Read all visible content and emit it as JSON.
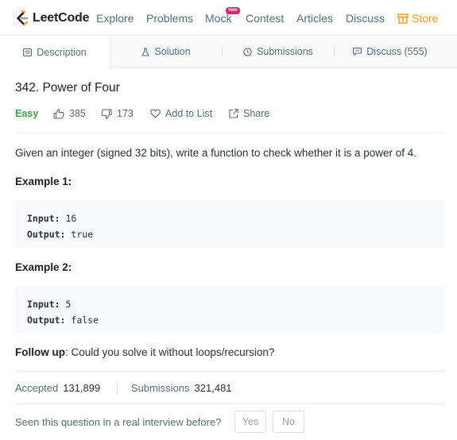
{
  "brand": {
    "name": "LeetCode"
  },
  "nav": {
    "links": [
      "Explore",
      "Problems",
      "Mock",
      "Contest",
      "Articles",
      "Discuss"
    ],
    "new_badge": "new",
    "store": "Store",
    "store_color": "#ff9800"
  },
  "tabs": [
    {
      "label": "Description",
      "icon": "description-icon"
    },
    {
      "label": "Solution",
      "icon": "flask-icon"
    },
    {
      "label": "Submissions",
      "icon": "clock-icon"
    },
    {
      "label": "Discuss (555)",
      "icon": "discuss-icon"
    }
  ],
  "problem": {
    "title": "342. Power of Four",
    "difficulty": "Easy",
    "difficulty_color": "#43a047",
    "likes": "385",
    "dislikes": "173",
    "add_to_list": "Add to List",
    "share": "Share",
    "description": "Given an integer (signed 32 bits), write a function to check whether it is a power of 4."
  },
  "examples": [
    {
      "title": "Example 1:",
      "input_label": "Input:",
      "input": "16",
      "output_label": "Output:",
      "output": "true"
    },
    {
      "title": "Example 2:",
      "input_label": "Input:",
      "input": "5",
      "output_label": "Output:",
      "output": "false"
    }
  ],
  "follow_up": {
    "label": "Follow up",
    "text": ": Could you solve it without loops/recursion?"
  },
  "stats": {
    "accepted_label": "Accepted",
    "accepted": "131,899",
    "submissions_label": "Submissions",
    "submissions": "321,481"
  },
  "interview": {
    "question": "Seen this question in a real interview before?",
    "yes": "Yes",
    "no": "No"
  }
}
